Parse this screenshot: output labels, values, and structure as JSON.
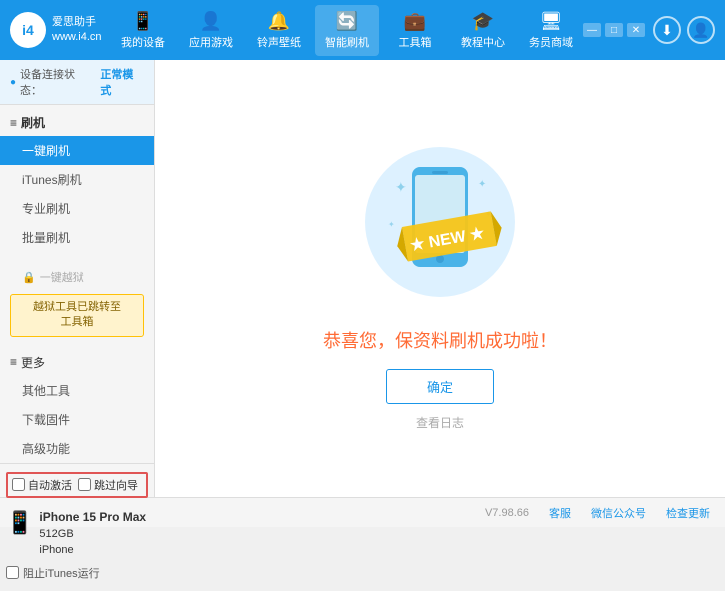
{
  "app": {
    "logo_text_line1": "爱思助手",
    "logo_text_line2": "www.i4.cn",
    "logo_abbr": "i4"
  },
  "nav": {
    "items": [
      {
        "id": "my-device",
        "icon": "📱",
        "label": "我的设备"
      },
      {
        "id": "apps-games",
        "icon": "👤",
        "label": "应用游戏"
      },
      {
        "id": "ringtone-dl",
        "icon": "🔔",
        "label": "铃声壁纸"
      },
      {
        "id": "smart-brush",
        "icon": "🔄",
        "label": "智能刷机",
        "active": true
      },
      {
        "id": "toolbox",
        "icon": "💼",
        "label": "工具箱"
      },
      {
        "id": "tutorial",
        "icon": "🎓",
        "label": "教程中心"
      },
      {
        "id": "service",
        "icon": "🖥",
        "label": "务员商域"
      }
    ]
  },
  "sidebar": {
    "status_label": "设备连接状态：",
    "status_value": "正常模式",
    "group_flash": "刷机",
    "items": [
      {
        "label": "一键刷机",
        "active": true
      },
      {
        "label": "iTunes刷机",
        "active": false
      },
      {
        "label": "专业刷机",
        "active": false
      },
      {
        "label": "批量刷机",
        "active": false
      }
    ],
    "disabled_label": "一键越狱",
    "warning_text": "越狱工具已跳转至\n工具箱",
    "more_label": "更多",
    "more_items": [
      {
        "label": "其他工具"
      },
      {
        "label": "下载固件"
      },
      {
        "label": "高级功能"
      }
    ],
    "checkbox1_label": "自动激活",
    "checkbox2_label": "跳过向导",
    "device_name": "iPhone 15 Pro Max",
    "device_storage": "512GB",
    "device_type": "iPhone",
    "block_itunes_label": "阻止iTunes运行"
  },
  "content": {
    "success_text": "恭喜您，保资料刷机成功啦！",
    "confirm_button": "确定",
    "view_log": "查看日志",
    "new_badge": "NEW"
  },
  "footer": {
    "version": "V7.98.66",
    "links": [
      "客服",
      "微信公众号",
      "检查更新"
    ]
  }
}
